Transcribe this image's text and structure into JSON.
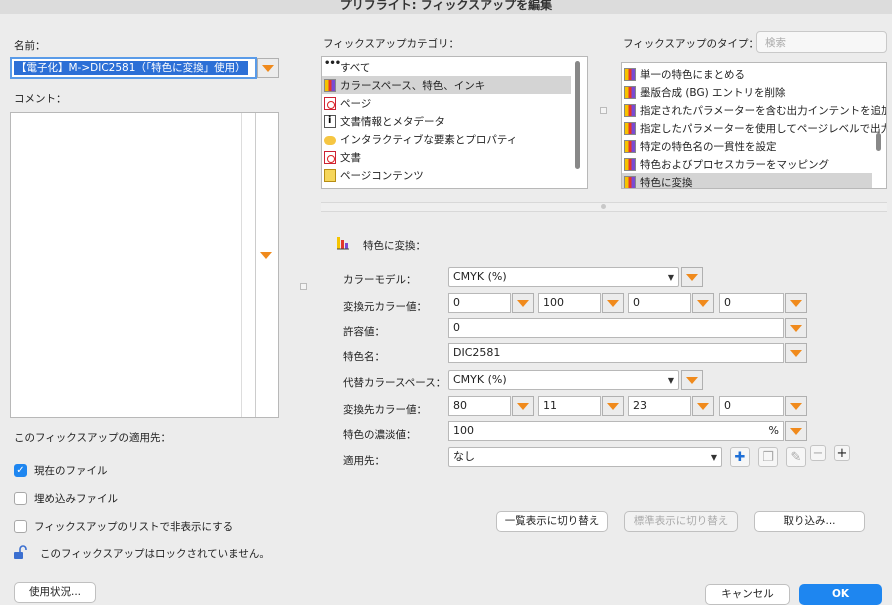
{
  "window": {
    "title": "プリフライト: フィックスアップを編集"
  },
  "left": {
    "name_label": "名前：",
    "name_value": "【電子化】M->DIC2581（「特色に変換」使用）",
    "comment_label": "コメント：",
    "apply_label": "このフィックスアップの適用先：",
    "checkboxes": [
      {
        "label": "現在のファイル",
        "checked": true
      },
      {
        "label": "埋め込みファイル",
        "checked": false
      },
      {
        "label": "フィックスアップのリストで非表示にする",
        "checked": false
      }
    ],
    "lock_text": "このフィックスアップはロックされていません。",
    "usage_button": "使用状況..."
  },
  "categories": {
    "label": "フィックスアップカテゴリ：",
    "items": [
      {
        "icon": "dots-icon",
        "label": "すべて",
        "selected": false
      },
      {
        "icon": "color-flask-icon",
        "label": "カラースペース、特色、インキ",
        "selected": true
      },
      {
        "icon": "pdf-icon",
        "label": "ページ",
        "selected": false
      },
      {
        "icon": "info-icon",
        "label": "文書情報とメタデータ",
        "selected": false
      },
      {
        "icon": "speech-bubble-icon",
        "label": "インタラクティブな要素とプロパティ",
        "selected": false
      },
      {
        "icon": "pdf-icon",
        "label": "文書",
        "selected": false
      },
      {
        "icon": "arrow-icon",
        "label": "ページコンテンツ",
        "selected": false
      }
    ]
  },
  "types": {
    "label": "フィックスアップのタイプ：",
    "search_placeholder": "検索",
    "items": [
      {
        "label": "単一の特色にまとめる",
        "selected": false
      },
      {
        "label": "墨版合成 (BG) エントリを削除",
        "selected": false
      },
      {
        "label": "指定されたパラメーターを含む出力インテントを追加",
        "selected": false
      },
      {
        "label": "指定したパラメーターを使用してページレベルで出力",
        "selected": false
      },
      {
        "label": "特定の特色名の一貫性を設定",
        "selected": false
      },
      {
        "label": "特色およびプロセスカラーをマッピング",
        "selected": false
      },
      {
        "label": "特色に変換",
        "selected": true
      }
    ]
  },
  "detail": {
    "heading": "特色に変換：",
    "color_model_label": "カラーモデル：",
    "color_model_value": "CMYK (%)",
    "source_values_label": "変換元カラー値：",
    "source_values": [
      "0",
      "100",
      "0",
      "0"
    ],
    "tolerance_label": "許容値：",
    "tolerance_value": "0",
    "spot_name_label": "特色名：",
    "spot_name_value": "DIC2581",
    "alt_space_label": "代替カラースペース：",
    "alt_space_value": "CMYK (%)",
    "dest_values_label": "変換先カラー値：",
    "dest_values": [
      "80",
      "11",
      "23",
      "0"
    ],
    "tint_label": "特色の濃淡値：",
    "tint_value": "100",
    "tint_unit": "%",
    "apply_to_label": "適用先：",
    "apply_to_value": "なし"
  },
  "buttons": {
    "list_view": "一覧表示に切り替え",
    "standard_view": "標準表示に切り替え",
    "import": "取り込み...",
    "cancel": "キャンセル",
    "ok": "OK"
  }
}
